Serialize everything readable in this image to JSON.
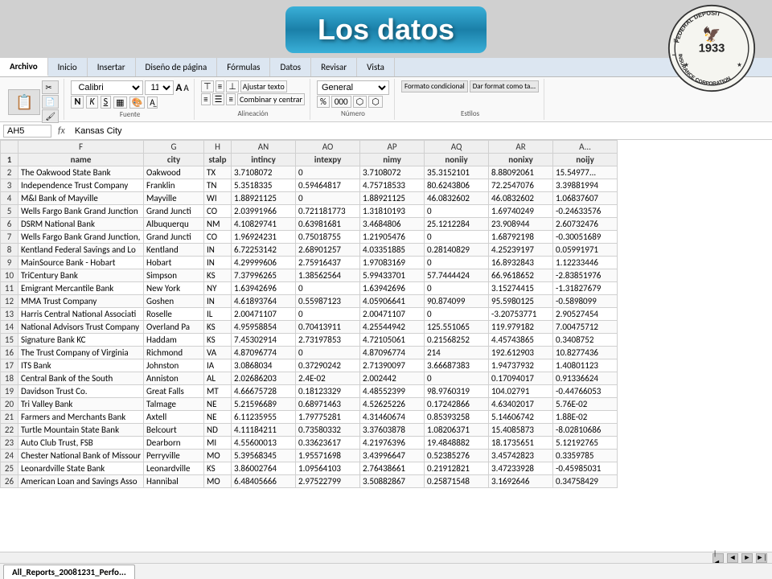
{
  "banner": {
    "title": "Los datos"
  },
  "ribbon": {
    "tabs": [
      "Archivo",
      "Inicio",
      "Insertar",
      "Diseño de página",
      "Fórmulas",
      "Datos",
      "Revisar",
      "Vista"
    ],
    "active_tab": "Archivo",
    "font": "Calibri",
    "size": "11",
    "groups": [
      "Portapap...",
      "Fuente",
      "Alineación",
      "Número",
      "Estilos"
    ],
    "wrap_text": "Ajustar texto",
    "combine_center": "Combinar y centrar",
    "format_conditional": "Formato condicional",
    "dar_formato": "Dar format como ta..."
  },
  "formula_bar": {
    "cell_ref": "AH5",
    "fx": "fx",
    "formula": "Kansas City"
  },
  "columns": [
    "",
    "F",
    "G",
    "H",
    "AN",
    "AO",
    "AP",
    "AQ",
    "AR",
    "A"
  ],
  "col_headers": [
    "",
    "F",
    "G",
    "H",
    "AN",
    "AO",
    "AP",
    "AQ",
    "AR",
    "A..."
  ],
  "rows": [
    {
      "num": "1",
      "f": "name",
      "g": "city",
      "h": "stalp",
      "an": "intincy",
      "ao": "intexpy",
      "ap": "nimy",
      "aq": "noniiy",
      "ar": "nonixy",
      "a": "noijy"
    },
    {
      "num": "2",
      "f": "The Oakwood State Bank",
      "g": "Oakwood",
      "h": "TX",
      "an": "3.7108072",
      "ao": "0",
      "ap": "3.7108072",
      "aq": "35.3152101",
      "ar": "8.88092061",
      "a": "15.54977..."
    },
    {
      "num": "3",
      "f": "Independence Trust Company",
      "g": "Franklin",
      "h": "TN",
      "an": "5.3518335",
      "ao": "0.59464817",
      "ap": "4.75718533",
      "aq": "80.6243806",
      "ar": "72.2547076",
      "a": "3.39881994"
    },
    {
      "num": "4",
      "f": "M&I Bank of Mayville",
      "g": "Mayville",
      "h": "WI",
      "an": "1.88921125",
      "ao": "0",
      "ap": "1.88921125",
      "aq": "46.0832602",
      "ar": "46.0832602",
      "a": "1.06837607"
    },
    {
      "num": "5",
      "f": "Wells Fargo Bank Grand Junction",
      "g": "Grand Juncti",
      "h": "CO",
      "an": "2.03991966",
      "ao": "0.721181773",
      "ap": "1.31810193",
      "aq": "0",
      "ar": "1.69740249",
      "a": "-0.24633576"
    },
    {
      "num": "6",
      "f": "DSRM National Bank",
      "g": "Albuquerqu",
      "h": "NM",
      "an": "4.10829741",
      "ao": "0.63981681",
      "ap": "3.4684806",
      "aq": "25.1212284",
      "ar": "23.908944",
      "a": "2.60732476"
    },
    {
      "num": "7",
      "f": "Wells Fargo Bank Grand Junction,",
      "g": "Grand Juncti",
      "h": "CO",
      "an": "1.96924231",
      "ao": "0.75018755",
      "ap": "1.21905476",
      "aq": "0",
      "ar": "1.68792198",
      "a": "-0.30051689"
    },
    {
      "num": "8",
      "f": "Kentland Federal Savings and Lo",
      "g": "Kentland",
      "h": "IN",
      "an": "6.72253142",
      "ao": "2.68901257",
      "ap": "4.03351885",
      "aq": "0.28140829",
      "ar": "4.25239197",
      "a": "0.05991971"
    },
    {
      "num": "9",
      "f": "MainSource Bank - Hobart",
      "g": "Hobart",
      "h": "IN",
      "an": "4.29999606",
      "ao": "2.75916437",
      "ap": "1.97083169",
      "aq": "0",
      "ar": "16.8932843",
      "a": "1.12233446"
    },
    {
      "num": "10",
      "f": "TriCentury Bank",
      "g": "Simpson",
      "h": "KS",
      "an": "7.37996265",
      "ao": "1.38562564",
      "ap": "5.99433701",
      "aq": "57.7444424",
      "ar": "66.9618652",
      "a": "-2.83851976"
    },
    {
      "num": "11",
      "f": "Emigrant Mercantile Bank",
      "g": "New York",
      "h": "NY",
      "an": "1.63942696",
      "ao": "0",
      "ap": "1.63942696",
      "aq": "0",
      "ar": "3.15274415",
      "a": "-1.31827679"
    },
    {
      "num": "12",
      "f": "MMA Trust Company",
      "g": "Goshen",
      "h": "IN",
      "an": "4.61893764",
      "ao": "0.55987123",
      "ap": "4.05906641",
      "aq": "90.874099",
      "ar": "95.5980125",
      "a": "-0.5898099"
    },
    {
      "num": "13",
      "f": "Harris Central National Associati",
      "g": "Roselle",
      "h": "IL",
      "an": "2.00471107",
      "ao": "0",
      "ap": "2.00471107",
      "aq": "0",
      "ar": "-3.20753771",
      "a": "2.90527454"
    },
    {
      "num": "14",
      "f": "National Advisors Trust Company",
      "g": "Overland Pa",
      "h": "KS",
      "an": "4.95958854",
      "ao": "0.70413911",
      "ap": "4.25544942",
      "aq": "125.551065",
      "ar": "119.979182",
      "a": "7.00475712"
    },
    {
      "num": "15",
      "f": "Signature Bank KC",
      "g": "Haddam",
      "h": "KS",
      "an": "7.45302914",
      "ao": "2.73197853",
      "ap": "4.72105061",
      "aq": "0.21568252",
      "ar": "4.45743865",
      "a": "0.3408752"
    },
    {
      "num": "16",
      "f": "The Trust Company of Virginia",
      "g": "Richmond",
      "h": "VA",
      "an": "4.87096774",
      "ao": "0",
      "ap": "4.87096774",
      "aq": "214",
      "ar": "192.612903",
      "a": "10.8277436"
    },
    {
      "num": "17",
      "f": "ITS Bank",
      "g": "Johnston",
      "h": "IA",
      "an": "3.0868034",
      "ao": "0.37290242",
      "ap": "2.71390097",
      "aq": "3.66687383",
      "ar": "1.94737932",
      "a": "1.40801123"
    },
    {
      "num": "18",
      "f": "Central Bank of the South",
      "g": "Anniston",
      "h": "AL",
      "an": "2.02686203",
      "ao": "2.4E-02",
      "ap": "2.002442",
      "aq": "0",
      "ar": "0.17094017",
      "a": "0.91336624"
    },
    {
      "num": "19",
      "f": "Davidson Trust Co.",
      "g": "Great Falls",
      "h": "MT",
      "an": "4.66675728",
      "ao": "0.18123329",
      "ap": "4.48552399",
      "aq": "98.9760319",
      "ar": "104.02791",
      "a": "-0.44766053"
    },
    {
      "num": "20",
      "f": "Tri Valley Bank",
      "g": "Talmage",
      "h": "NE",
      "an": "5.21596689",
      "ao": "0.68971463",
      "ap": "4.52625226",
      "aq": "0.17242866",
      "ar": "4.63402017",
      "a": "5.76E-02"
    },
    {
      "num": "21",
      "f": "Farmers and Merchants Bank",
      "g": "Axtell",
      "h": "NE",
      "an": "6.11235955",
      "ao": "1.79775281",
      "ap": "4.31460674",
      "aq": "0.85393258",
      "ar": "5.14606742",
      "a": "1.88E-02"
    },
    {
      "num": "22",
      "f": "Turtle Mountain State Bank",
      "g": "Belcourt",
      "h": "ND",
      "an": "4.11184211",
      "ao": "0.73580332",
      "ap": "3.37603878",
      "aq": "1.08206371",
      "ar": "15.4085873",
      "a": "-8.02810686"
    },
    {
      "num": "23",
      "f": "Auto Club Trust, FSB",
      "g": "Dearborn",
      "h": "MI",
      "an": "4.55600013",
      "ao": "0.33623617",
      "ap": "4.21976396",
      "aq": "19.4848882",
      "ar": "18.1735651",
      "a": "5.12192765"
    },
    {
      "num": "24",
      "f": "Chester National Bank of Missour",
      "g": "Perryville",
      "h": "MO",
      "an": "5.39568345",
      "ao": "1.95571698",
      "ap": "3.43996647",
      "aq": "0.52385276",
      "ar": "3.45742823",
      "a": "0.3359785"
    },
    {
      "num": "25",
      "f": "Leonardville State Bank",
      "g": "Leonardville",
      "h": "KS",
      "an": "3.86002764",
      "ao": "1.09564103",
      "ap": "2.76438661",
      "aq": "0.21912821",
      "ar": "3.47233928",
      "a": "-0.45985031"
    },
    {
      "num": "26",
      "f": "American Loan and Savings Asso",
      "g": "Hannibal",
      "h": "MO",
      "an": "6.48405666",
      "ao": "2.97522799",
      "ap": "3.50882867",
      "aq": "0.25871548",
      "ar": "3.1692646",
      "a": "0.34758429"
    }
  ],
  "sheet_tab": "All_Reports_20081231_Perfo...",
  "fdic": {
    "year": "1933",
    "text": "FEDERAL DEPOSIT INSURANCE CORPORATION"
  }
}
